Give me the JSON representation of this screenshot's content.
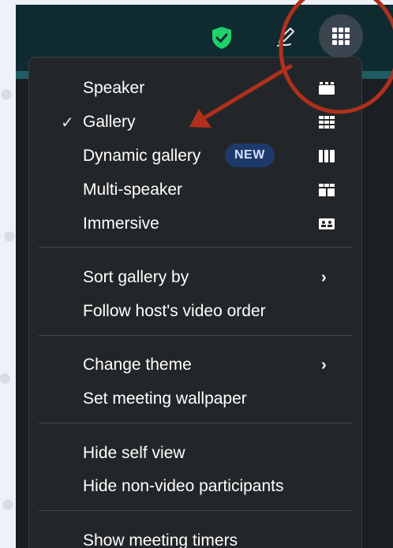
{
  "menu": {
    "view_group": [
      {
        "label": "Speaker",
        "checked": false,
        "icon": "speaker-view-icon"
      },
      {
        "label": "Gallery",
        "checked": true,
        "icon": "gallery-view-icon"
      },
      {
        "label": "Dynamic gallery",
        "checked": false,
        "icon": "dynamic-gallery-icon",
        "badge": "NEW"
      },
      {
        "label": "Multi-speaker",
        "checked": false,
        "icon": "multi-speaker-icon"
      },
      {
        "label": "Immersive",
        "checked": false,
        "icon": "immersive-icon"
      }
    ],
    "sort_group": [
      {
        "label": "Sort gallery by",
        "submenu": true
      },
      {
        "label": "Follow host's video order",
        "submenu": false
      }
    ],
    "theme_group": [
      {
        "label": "Change theme",
        "submenu": true
      },
      {
        "label": "Set meeting wallpaper",
        "submenu": false
      }
    ],
    "self_group": [
      {
        "label": "Hide self view"
      },
      {
        "label": "Hide non-video participants"
      }
    ],
    "timer_group": [
      {
        "label": "Show meeting timers"
      }
    ],
    "check_glyph": "✓",
    "chevron_glyph": "›"
  },
  "toolbar": {
    "icons": [
      "shield-check-icon",
      "annotate-icon",
      "view-grid-icon"
    ]
  },
  "colors": {
    "menu_bg": "#232628",
    "toolbar_bg": "#0f2b30",
    "shield": "#1fd06b",
    "badge_bg": "#1e3a6b",
    "annotation": "#b0301d"
  }
}
